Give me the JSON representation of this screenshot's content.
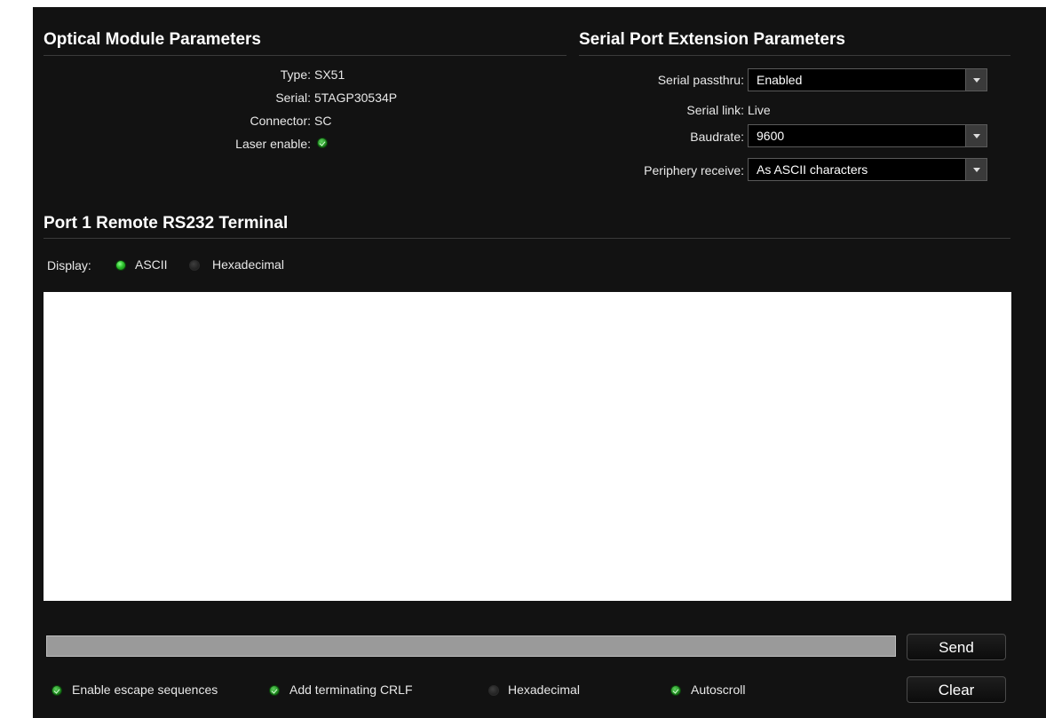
{
  "optical": {
    "title": "Optical Module Parameters",
    "type_label": "Type:",
    "type_value": "SX51",
    "serial_label": "Serial:",
    "serial_value": "5TAGP30534P",
    "connector_label": "Connector:",
    "connector_value": "SC",
    "laser_label": "Laser enable:",
    "laser_icon": "check-led",
    "laser_enabled": true
  },
  "serial_ext": {
    "title": "Serial Port Extension Parameters",
    "passthru_label": "Serial passthru:",
    "passthru_value": "Enabled",
    "link_label": "Serial link:",
    "link_value": "Live",
    "baudrate_label": "Baudrate:",
    "baudrate_value": "9600",
    "periphery_label": "Periphery receive:",
    "periphery_value": "As ASCII characters"
  },
  "terminal": {
    "title": "Port 1 Remote RS232 Terminal",
    "display_label": "Display:",
    "display_options": [
      {
        "label": "ASCII",
        "selected": true
      },
      {
        "label": "Hexadecimal",
        "selected": false
      }
    ],
    "output_text": "",
    "input_value": "",
    "send_label": "Send",
    "clear_label": "Clear",
    "options": [
      {
        "label": "Enable escape sequences",
        "checked": true
      },
      {
        "label": "Add terminating CRLF",
        "checked": true
      },
      {
        "label": "Hexadecimal",
        "checked": false
      },
      {
        "label": "Autoscroll",
        "checked": true
      }
    ]
  },
  "colors": {
    "panel_bg": "#121212",
    "text": "#e8e8e8",
    "led_on": "#2cc22c",
    "input_bg": "#9a9a9a"
  }
}
